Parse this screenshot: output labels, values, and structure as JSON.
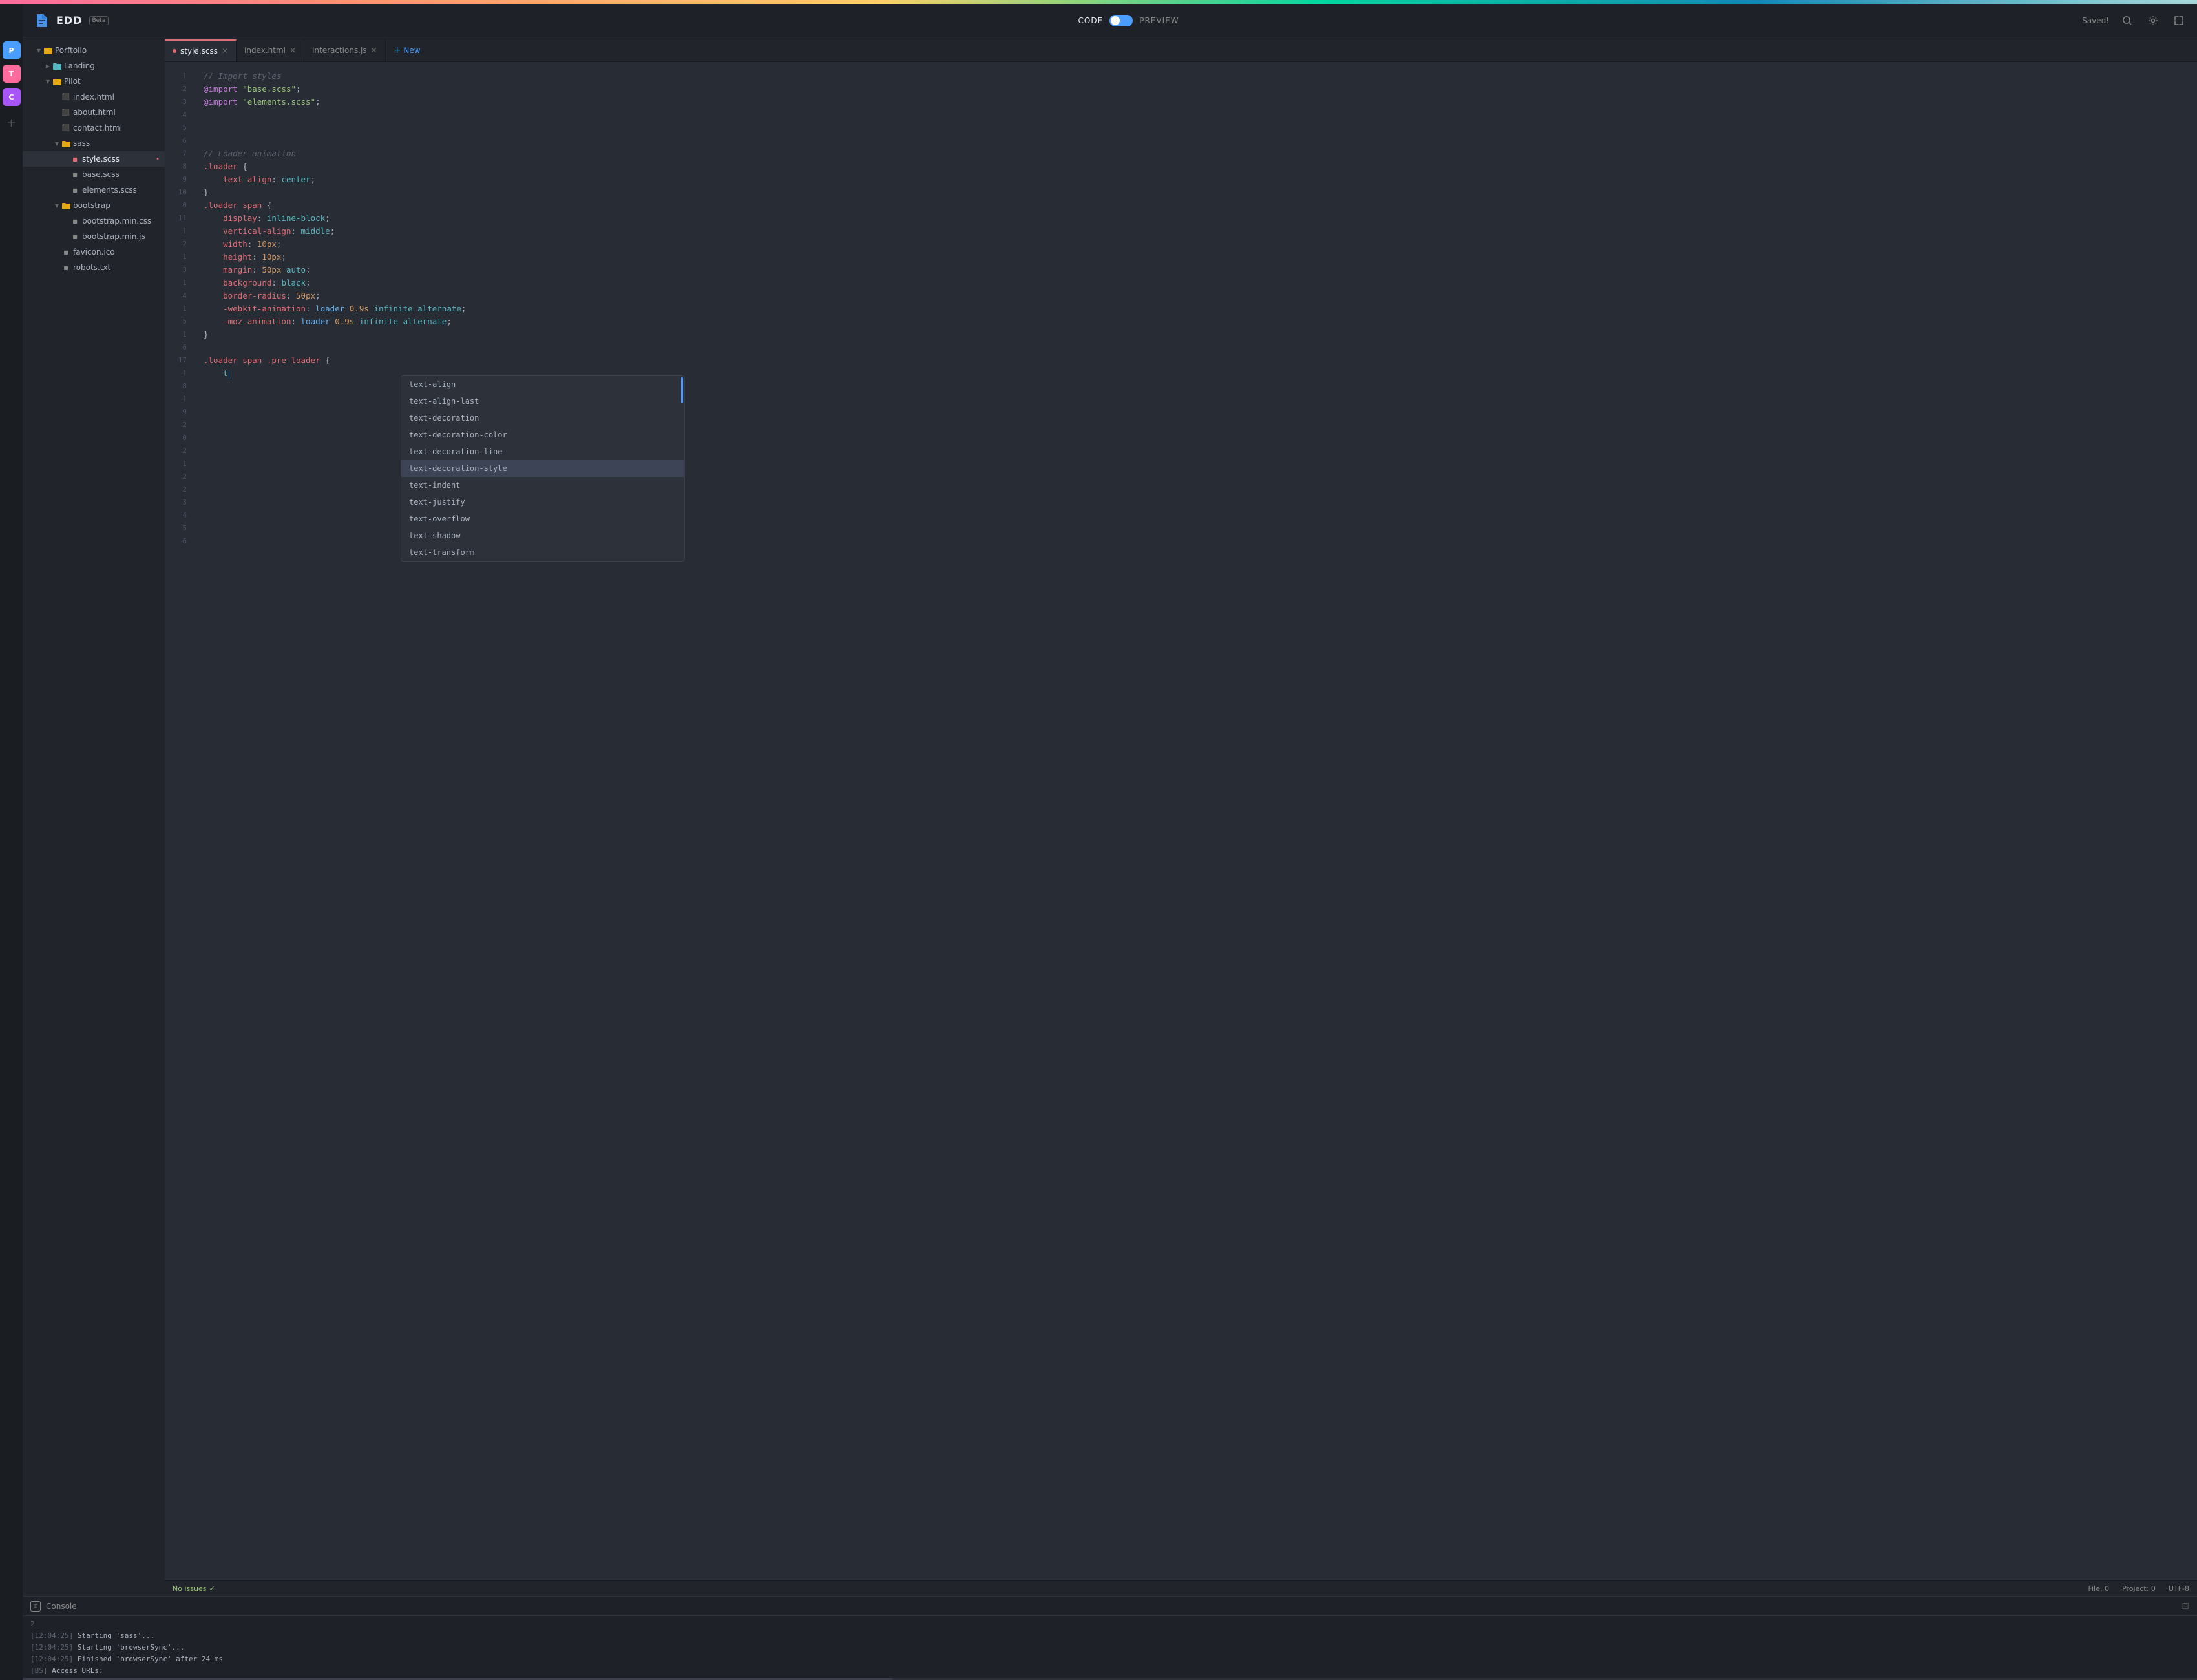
{
  "app": {
    "title": "EDD",
    "beta": "Beta"
  },
  "header": {
    "toggle_code": "CODE",
    "toggle_preview": "PREVIEW",
    "saved_label": "Saved!",
    "search_icon": "search",
    "settings_icon": "gear",
    "expand_icon": "expand"
  },
  "activity_bar": {
    "items": [
      {
        "label": "P",
        "class": "active-p"
      },
      {
        "label": "T",
        "class": "active-t"
      },
      {
        "label": "C",
        "class": "active-c"
      }
    ],
    "add_label": "+"
  },
  "sidebar": {
    "items": [
      {
        "label": "Porftolio",
        "type": "folder",
        "indent": 0,
        "expanded": true,
        "level": 1
      },
      {
        "label": "Landing",
        "type": "folder",
        "indent": 1,
        "expanded": false,
        "level": 2
      },
      {
        "label": "Pilot",
        "type": "folder",
        "indent": 1,
        "expanded": true,
        "level": 2
      },
      {
        "label": "index.html",
        "type": "file",
        "indent": 2,
        "level": 3
      },
      {
        "label": "about.html",
        "type": "file",
        "indent": 2,
        "level": 3
      },
      {
        "label": "contact.html",
        "type": "file",
        "indent": 2,
        "level": 3
      },
      {
        "label": "sass",
        "type": "folder",
        "indent": 2,
        "expanded": true,
        "level": 3
      },
      {
        "label": "style.scss",
        "type": "file-active",
        "indent": 3,
        "level": 4,
        "modified": true
      },
      {
        "label": "base.scss",
        "type": "file",
        "indent": 3,
        "level": 4
      },
      {
        "label": "elements.scss",
        "type": "file",
        "indent": 3,
        "level": 4
      },
      {
        "label": "bootstrap",
        "type": "folder",
        "indent": 2,
        "expanded": true,
        "level": 3
      },
      {
        "label": "bootstrap.min.css",
        "type": "file",
        "indent": 3,
        "level": 4
      },
      {
        "label": "bootstrap.min.js",
        "type": "file",
        "indent": 3,
        "level": 4
      },
      {
        "label": "favicon.ico",
        "type": "file",
        "indent": 2,
        "level": 3
      },
      {
        "label": "robots.txt",
        "type": "file",
        "indent": 2,
        "level": 3
      }
    ]
  },
  "tabs": [
    {
      "label": "style.scss",
      "active": true,
      "modified": true,
      "closable": true
    },
    {
      "label": "index.html",
      "active": false,
      "closable": true
    },
    {
      "label": "interactions.js",
      "active": false,
      "closable": true
    },
    {
      "label": "New",
      "active": false,
      "is_new": true
    }
  ],
  "code_lines": [
    {
      "num": "1",
      "content": "// Import styles",
      "type": "comment"
    },
    {
      "num": "2",
      "content": "@import \"base.scss\";",
      "type": "import"
    },
    {
      "num": "3",
      "content": "@import \"elements.scss\";",
      "type": "import"
    },
    {
      "num": "4",
      "content": "",
      "type": "empty"
    },
    {
      "num": "5",
      "content": "",
      "type": "empty"
    },
    {
      "num": "6",
      "content": "",
      "type": "empty"
    },
    {
      "num": "7",
      "content": "// Loader animation",
      "type": "comment"
    },
    {
      "num": "8",
      "content": ".loader {",
      "type": "selector"
    },
    {
      "num": "9",
      "content": "  text-align: center;",
      "type": "property"
    },
    {
      "num": "10",
      "content": "}",
      "type": "brace"
    },
    {
      "num": "0",
      "content": ".loader span {",
      "type": "selector"
    },
    {
      "num": "11",
      "content": "  display: inline-block;",
      "type": "property"
    },
    {
      "num": "1",
      "content": "  vertical-align: middle;",
      "type": "property"
    },
    {
      "num": "2",
      "content": "  width: 10px;",
      "type": "property"
    },
    {
      "num": "1",
      "content": "  height: 10px;",
      "type": "property"
    },
    {
      "num": "3",
      "content": "  margin: 50px auto;",
      "type": "property"
    },
    {
      "num": "1",
      "content": "  background: black;",
      "type": "property"
    },
    {
      "num": "4",
      "content": "  border-radius: 50px;",
      "type": "property"
    },
    {
      "num": "1",
      "content": "  -webkit-animation: loader 0.9s infinite alternate;",
      "type": "property"
    },
    {
      "num": "5",
      "content": "  -moz-animation: loader 0.9s infinite alternate;",
      "type": "property"
    },
    {
      "num": "1",
      "content": "}",
      "type": "brace"
    },
    {
      "num": "6",
      "content": "",
      "type": "empty"
    },
    {
      "num": "17",
      "content": ".loader span .pre-loader {",
      "type": "selector"
    },
    {
      "num": "1",
      "content": "  t|",
      "type": "cursor"
    },
    {
      "num": "8",
      "content": "",
      "type": "empty"
    },
    {
      "num": "1",
      "content": "",
      "type": "empty"
    },
    {
      "num": "9",
      "content": "",
      "type": "empty"
    },
    {
      "num": "2",
      "content": "",
      "type": "empty"
    },
    {
      "num": "0",
      "content": "",
      "type": "empty"
    },
    {
      "num": "2",
      "content": "",
      "type": "empty"
    },
    {
      "num": "1",
      "content": "",
      "type": "empty"
    },
    {
      "num": "2",
      "content": "",
      "type": "empty"
    },
    {
      "num": "2",
      "content": "",
      "type": "empty"
    },
    {
      "num": "3",
      "content": "",
      "type": "empty"
    },
    {
      "num": "4",
      "content": "",
      "type": "empty"
    },
    {
      "num": "5",
      "content": "",
      "type": "empty"
    },
    {
      "num": "6",
      "content": "",
      "type": "empty"
    }
  ],
  "autocomplete": {
    "items": [
      {
        "label": "text-align",
        "highlighted": false
      },
      {
        "label": "text-align-last",
        "highlighted": false
      },
      {
        "label": "text-decoration",
        "highlighted": false
      },
      {
        "label": "text-decoration-color",
        "highlighted": false
      },
      {
        "label": "text-decoration-line",
        "highlighted": false
      },
      {
        "label": "text-decoration-style",
        "highlighted": true
      },
      {
        "label": "text-indent",
        "highlighted": false
      },
      {
        "label": "text-justify",
        "highlighted": false
      },
      {
        "label": "text-overflow",
        "highlighted": false
      },
      {
        "label": "text-shadow",
        "highlighted": false
      },
      {
        "label": "text-transform",
        "highlighted": false
      }
    ]
  },
  "status_bar": {
    "no_issues": "No issues",
    "file_label": "File: 0",
    "project_label": "Project: 0",
    "encoding": "UTF-8"
  },
  "console": {
    "title": "Console",
    "lines": [
      {
        "text": "2"
      },
      {
        "time": "[12:04:25]",
        "msg": " Starting 'sass'..."
      },
      {
        "time": "[12:04:25]",
        "msg": " Starting 'browserSync'..."
      },
      {
        "time": "[12:04:25]",
        "msg": " Finished 'browserSync' after 24 ms"
      },
      {
        "time": "[BS]",
        "msg": " Access URLs:"
      }
    ]
  }
}
